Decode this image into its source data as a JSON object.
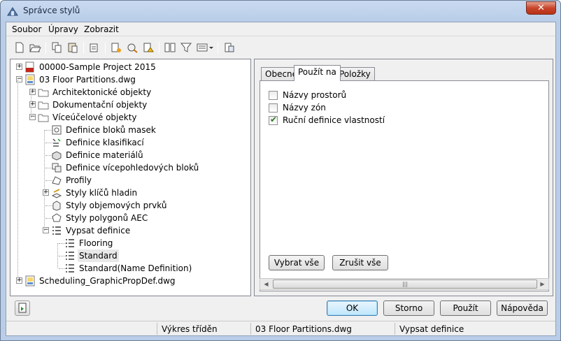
{
  "window": {
    "title": "Správce stylů",
    "close_glyph": "✕"
  },
  "menu": [
    "Soubor",
    "Úpravy",
    "Zobrazit"
  ],
  "toolbar_icons": [
    "new-icon",
    "open-icon",
    "copy-icon",
    "paste-icon",
    "purge-icon",
    "new-style-icon",
    "edit-style-icon",
    "set-current-icon",
    "toggle-view-icon",
    "filter-icon",
    "view-options-icon",
    "inline-edit-icon"
  ],
  "tree": [
    {
      "label": "00000-Sample Project 2015",
      "level": 0,
      "expander": "+",
      "icon": "project-icon"
    },
    {
      "label": "03 Floor Partitions.dwg",
      "level": 0,
      "expander": "−",
      "icon": "drawing-icon"
    },
    {
      "label": "Architektonické objekty",
      "level": 1,
      "expander": "+",
      "icon": "folder-icon"
    },
    {
      "label": "Dokumentační objekty",
      "level": 1,
      "expander": "+",
      "icon": "folder-icon"
    },
    {
      "label": "Víceúčelové objekty",
      "level": 1,
      "expander": "−",
      "icon": "folder-icon"
    },
    {
      "label": "Definice bloků masek",
      "level": 2,
      "expander": "",
      "icon": "mask-block-icon"
    },
    {
      "label": "Definice klasifikací",
      "level": 2,
      "expander": "",
      "icon": "classification-icon"
    },
    {
      "label": "Definice materiálů",
      "level": 2,
      "expander": "",
      "icon": "material-icon"
    },
    {
      "label": "Definice vícepohledových bloků",
      "level": 2,
      "expander": "",
      "icon": "multiview-block-icon"
    },
    {
      "label": "Profily",
      "level": 2,
      "expander": "",
      "icon": "profile-icon"
    },
    {
      "label": "Styly klíčů hladin",
      "level": 2,
      "expander": "+",
      "icon": "layer-key-icon"
    },
    {
      "label": "Styly objemových prvků",
      "level": 2,
      "expander": "",
      "icon": "mass-element-icon"
    },
    {
      "label": "Styly polygonů AEC",
      "level": 2,
      "expander": "",
      "icon": "polygon-icon"
    },
    {
      "label": "Vypsat definice",
      "level": 2,
      "expander": "−",
      "icon": "list-definition-icon"
    },
    {
      "label": "Flooring",
      "level": 3,
      "expander": "",
      "icon": "list-definition-icon"
    },
    {
      "label": "Standard",
      "level": 3,
      "expander": "",
      "icon": "list-definition-icon",
      "selected": true
    },
    {
      "label": "Standard(Name Definition)",
      "level": 3,
      "expander": "",
      "icon": "list-definition-icon"
    },
    {
      "label": "Scheduling_GraphicPropDef.dwg",
      "level": 0,
      "expander": "+",
      "icon": "drawing-icon"
    }
  ],
  "tabs": [
    {
      "label": "Obecné",
      "active": false
    },
    {
      "label": "Použít na",
      "active": true
    },
    {
      "label": "Položky",
      "active": false
    }
  ],
  "apply_to": [
    {
      "label": "Názvy prostorů",
      "checked": false
    },
    {
      "label": "Názvy zón",
      "checked": false
    },
    {
      "label": "Ruční definice vlastností",
      "checked": true
    }
  ],
  "check_glyph": "✔",
  "select_all": "Vybrat vše",
  "clear_all": "Zrušit vše",
  "scroll": {
    "left": "◀",
    "right": "▶",
    "grip": "|||"
  },
  "buttons": {
    "ok": "OK",
    "cancel": "Storno",
    "apply": "Použít",
    "help": "Nápověda"
  },
  "status": {
    "sort": "Výkres tříděn",
    "drawing": "03 Floor Partitions.dwg",
    "type": "Vypsat definice"
  }
}
